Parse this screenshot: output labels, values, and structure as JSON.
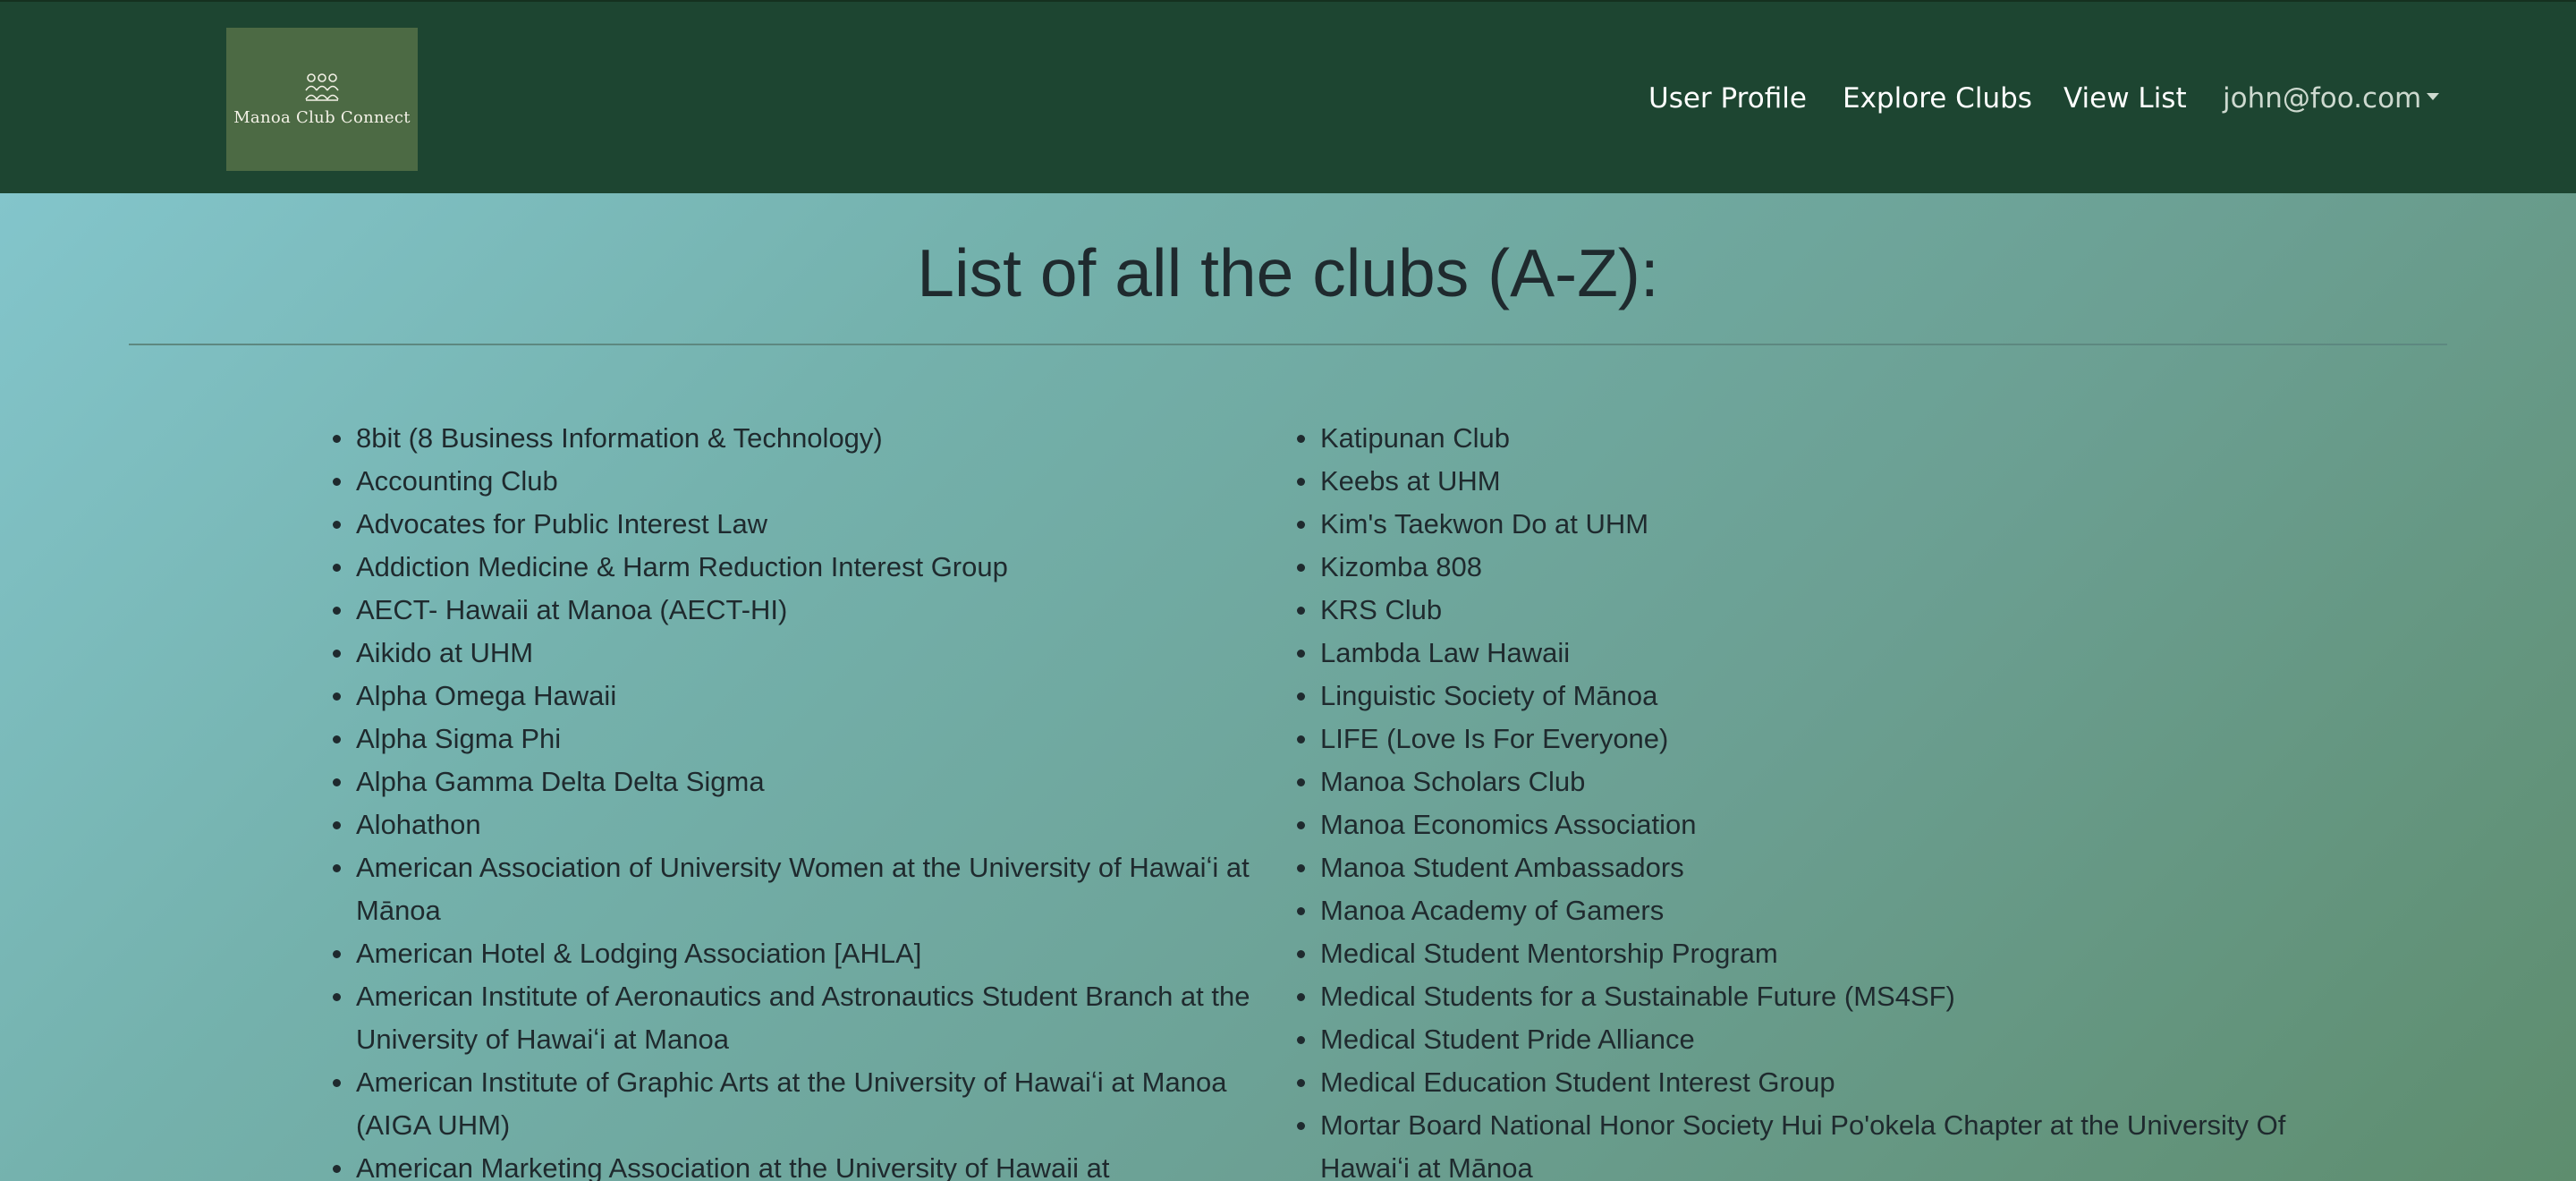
{
  "navbar": {
    "logo_text": "Manoa Club Connect",
    "links": [
      {
        "label": "User Profile"
      },
      {
        "label": "Explore Clubs"
      },
      {
        "label": "View List"
      }
    ],
    "user_menu_label": "john@foo.com"
  },
  "page": {
    "title": "List of all the clubs (A-Z):"
  },
  "clubs": {
    "left": [
      "8bit (8 Business Information & Technology)",
      "Accounting Club",
      "Advocates for Public Interest Law",
      "Addiction Medicine & Harm Reduction Interest Group",
      "AECT- Hawaii at Manoa (AECT-HI)",
      "Aikido at UHM",
      "Alpha Omega Hawaii",
      "Alpha Sigma Phi",
      "Alpha Gamma Delta Delta Sigma",
      "Alohathon",
      "American Association of University Women at the University of Hawaiʻi at Mānoa",
      "American Hotel & Lodging Association [AHLA]",
      "American Institute of Aeronautics and Astronautics Student Branch at the University of Hawaiʻi at Manoa",
      "American Institute of Graphic Arts at the University of Hawaiʻi at Manoa (AIGA UHM)",
      "American Marketing Association at the University of Hawaii at"
    ],
    "right": [
      "Katipunan Club",
      "Keebs at UHM",
      "Kim's Taekwon Do at UHM",
      "Kizomba 808",
      "KRS Club",
      "Lambda Law Hawaii",
      "Linguistic Society of Mānoa",
      "LIFE (Love Is For Everyone)",
      "Manoa Scholars Club",
      "Manoa Economics Association",
      "Manoa Student Ambassadors",
      "Manoa Academy of Gamers",
      "Medical Student Mentorship Program",
      "Medical Students for a Sustainable Future (MS4SF)",
      "Medical Student Pride Alliance",
      "Medical Education Student Interest Group",
      "Mortar Board National Honor Society Hui Po'okela Chapter at the University Of Hawaiʻi at Mānoa"
    ]
  }
}
